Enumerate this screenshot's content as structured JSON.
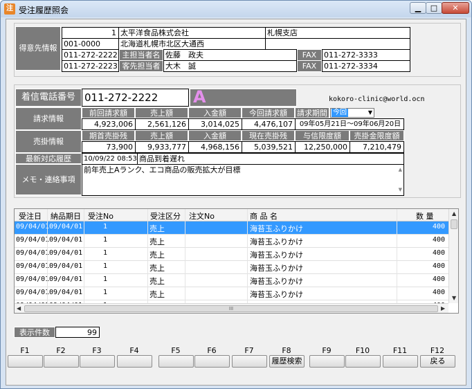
{
  "window": {
    "title": "受注履歴照会",
    "app_icon": "注"
  },
  "customer": {
    "section_label": "得意先情報",
    "code_no": "1",
    "name": "太平洋食品株式会社",
    "branch": "札幌支店",
    "zip": "001-0000",
    "address": "北海道札幌市北区大通西",
    "tel1": "011-272-2222",
    "main_rep_label": "主担当者名",
    "main_rep": "佐藤　政夫",
    "fax_label1": "FAX",
    "fax1": "011-272-3333",
    "tel2": "011-272-2223",
    "sub_rep_label": "客先担当者",
    "sub_rep": "大木　誠",
    "fax_label2": "FAX",
    "fax2": "011-272-3334"
  },
  "incoming": {
    "label": "着信電話番号",
    "phone": "011-272-2222",
    "rank": "A",
    "email": "kokoro-clinic@world.ocn"
  },
  "billing": {
    "label": "請求情報",
    "headers": [
      "前回請求額",
      "売上額",
      "入金額",
      "今回請求額"
    ],
    "values": [
      "4,923,006",
      "2,561,126",
      "3,014,025",
      "4,476,107"
    ],
    "period_label": "請求期間",
    "period_select": "今回",
    "period_value": "09年05月21日～09年06月20日"
  },
  "receivable": {
    "label": "売掛情報",
    "headers": [
      "期首売掛残",
      "売上額",
      "入金額",
      "現在売掛残",
      "与信限度額",
      "売掛金限度額"
    ],
    "values": [
      "73,900",
      "9,933,777",
      "4,968,156",
      "5,039,521",
      "12,250,000",
      "7,210,479"
    ]
  },
  "latest": {
    "label": "最新対応履歴",
    "datetime": "10/09/22 08:53",
    "text": "商品到着遅れ"
  },
  "memo": {
    "label": "メモ・連絡事項",
    "text": "前年売上Aランク、エコ商品の販売拡大が目標"
  },
  "grid": {
    "headers": [
      "受注日",
      "納品期日",
      "受注No",
      "受注区分",
      "注文No",
      "商 品 名",
      "数 量"
    ],
    "rows": [
      {
        "order_date": "09/04/01",
        "due_date": "09/04/01",
        "no": "1",
        "type": "売上",
        "po": "",
        "product": "海苔玉ふりかけ",
        "qty": "400"
      },
      {
        "order_date": "09/04/01",
        "due_date": "09/04/01",
        "no": "1",
        "type": "売上",
        "po": "",
        "product": "海苔玉ふりかけ",
        "qty": "400"
      },
      {
        "order_date": "09/04/01",
        "due_date": "09/04/01",
        "no": "1",
        "type": "売上",
        "po": "",
        "product": "海苔玉ふりかけ",
        "qty": "400"
      },
      {
        "order_date": "09/04/01",
        "due_date": "09/04/01",
        "no": "1",
        "type": "売上",
        "po": "",
        "product": "海苔玉ふりかけ",
        "qty": "400"
      },
      {
        "order_date": "09/04/01",
        "due_date": "09/04/01",
        "no": "1",
        "type": "売上",
        "po": "",
        "product": "海苔玉ふりかけ",
        "qty": "400"
      },
      {
        "order_date": "09/04/01",
        "due_date": "09/04/01",
        "no": "1",
        "type": "売上",
        "po": "",
        "product": "海苔玉ふりかけ",
        "qty": "400"
      },
      {
        "order_date": "09/04/01",
        "due_date": "09/04/01",
        "no": "1",
        "type": "売上",
        "po": "",
        "product": "海苔玉ふりかけ",
        "qty": "400"
      }
    ],
    "hscroll_thumb": "III"
  },
  "count": {
    "label": "表示件数",
    "value": "99"
  },
  "fkeys": {
    "labels": [
      "F1",
      "F2",
      "F3",
      "F4",
      "F5",
      "F6",
      "F7",
      "F8",
      "F9",
      "F10",
      "F11",
      "F12"
    ],
    "buttons": [
      "",
      "",
      "",
      "",
      "",
      "",
      "",
      "履歴検索",
      "",
      "",
      "",
      "戻る"
    ]
  },
  "colors": {
    "label_gray": "#7b7b7b",
    "selection": "#3399ff",
    "rank": "#d080e0"
  }
}
